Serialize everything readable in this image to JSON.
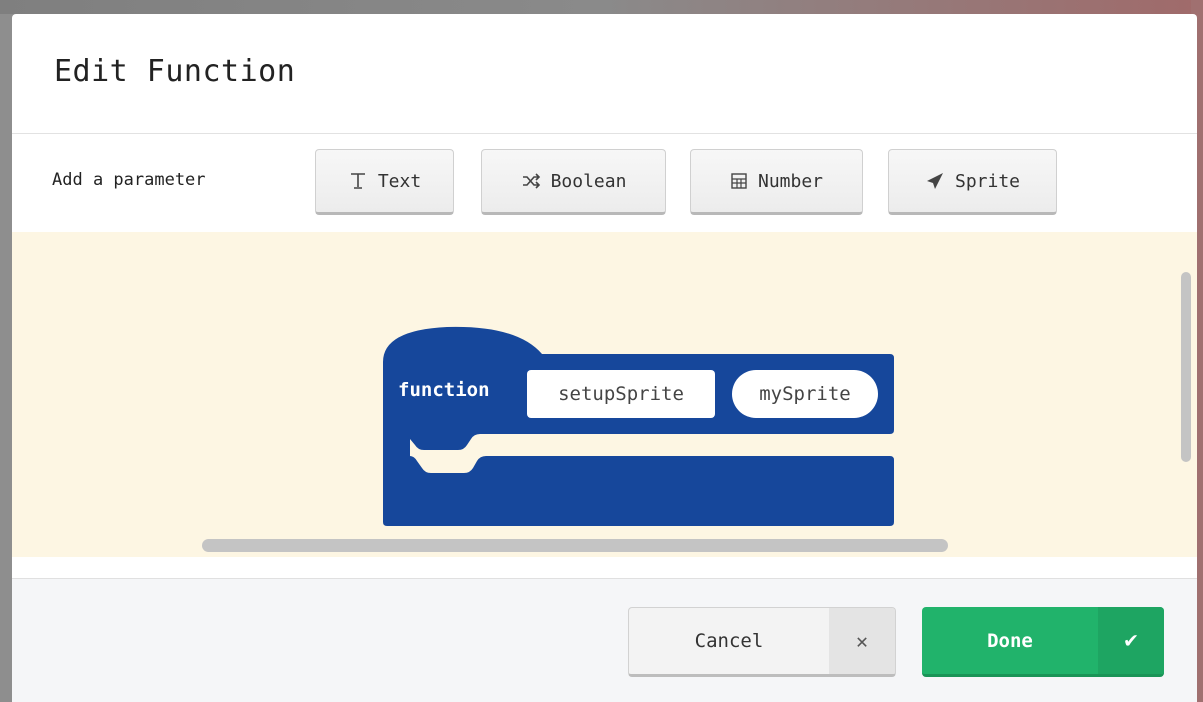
{
  "dialog": {
    "title": "Edit Function"
  },
  "parameters": {
    "label": "Add a parameter",
    "buttons": [
      {
        "label": "Text",
        "icon": "text-cursor-icon"
      },
      {
        "label": "Boolean",
        "icon": "shuffle-icon"
      },
      {
        "label": "Number",
        "icon": "calculator-icon"
      },
      {
        "label": "Sprite",
        "icon": "paper-plane-icon"
      }
    ]
  },
  "block": {
    "keyword": "function",
    "name": "setupSprite",
    "param": "mySprite",
    "color": "#16479b"
  },
  "footer": {
    "cancel_label": "Cancel",
    "cancel_icon": "close-icon",
    "done_label": "Done",
    "done_icon": "check-icon"
  },
  "colors": {
    "canvas_bg": "#fdf6e3",
    "done_green": "#21b36b",
    "block_blue": "#16479b"
  }
}
